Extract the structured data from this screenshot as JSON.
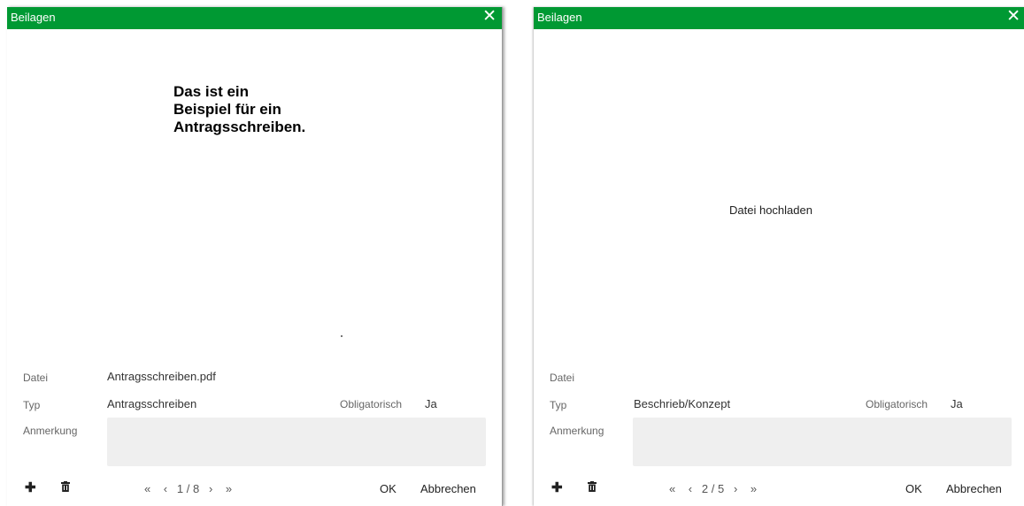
{
  "dialogs": [
    {
      "title": "Beilagen",
      "close_icon": "close-icon",
      "preview": {
        "document_lines": [
          "Das ist ein",
          "Beispiel für ein",
          "Antragsschreiben."
        ]
      },
      "fields": {
        "datei_label": "Datei",
        "datei_value": "Antragsschreiben.pdf",
        "typ_label": "Typ",
        "typ_value": "Antragsschreiben",
        "obligatorisch_label": "Obligatorisch",
        "obligatorisch_value": "Ja",
        "anmerkung_label": "Anmerkung",
        "anmerkung_value": ""
      },
      "footer": {
        "add_icon": "plus-icon",
        "delete_icon": "trash-icon",
        "first": "«",
        "prev": "‹",
        "page": "1 / 8",
        "next": "›",
        "last": "»",
        "ok_label": "OK",
        "cancel_label": "Abbrechen"
      }
    },
    {
      "title": "Beilagen",
      "close_icon": "close-icon",
      "preview": {
        "upload_label": "Datei hochladen"
      },
      "fields": {
        "datei_label": "Datei",
        "datei_value": "",
        "typ_label": "Typ",
        "typ_value": "Beschrieb/Konzept",
        "obligatorisch_label": "Obligatorisch",
        "obligatorisch_value": "Ja",
        "anmerkung_label": "Anmerkung",
        "anmerkung_value": ""
      },
      "footer": {
        "add_icon": "plus-icon",
        "delete_icon": "trash-icon",
        "first": "«",
        "prev": "‹",
        "page": "2 / 5",
        "next": "›",
        "last": "»",
        "ok_label": "OK",
        "cancel_label": "Abbrechen"
      }
    }
  ],
  "colors": {
    "titlebar": "#009933",
    "note_background": "#efefef"
  }
}
